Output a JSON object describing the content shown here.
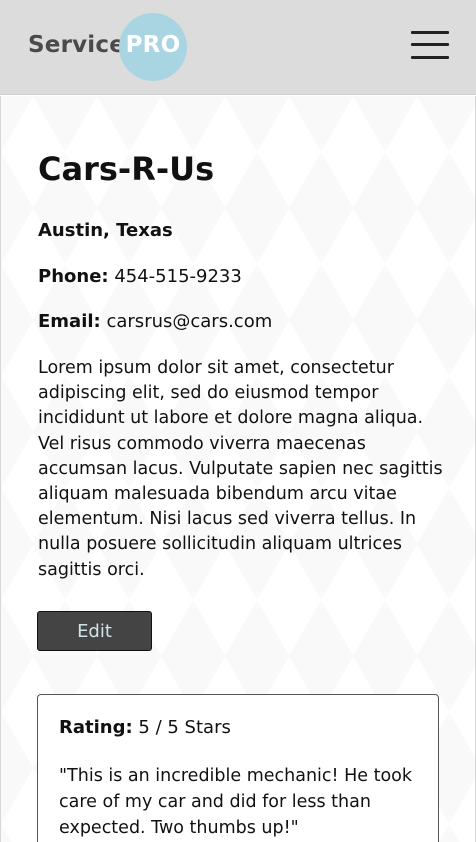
{
  "header": {
    "logo_service": "Service",
    "logo_pro": "PRO",
    "menu_icon": "hamburger-menu-icon"
  },
  "business": {
    "name": "Cars-R-Us",
    "location": "Austin, Texas",
    "phone_label": "Phone:",
    "phone": "454-515-9233",
    "email_label": "Email:",
    "email": "carsrus@cars.com",
    "description": "Lorem ipsum dolor sit amet, consectetur adipiscing elit, sed do eiusmod tempor incididunt ut labore et dolore magna aliqua. Vel risus commodo viverra maecenas accumsan lacus. Vulputate sapien nec sagittis aliquam malesuada bibendum arcu vitae elementum. Nisi lacus sed viverra tellus. In nulla posuere sollicitudin aliquam ultrices sagittis orci."
  },
  "actions": {
    "edit_label": "Edit"
  },
  "review": {
    "rating_label": "Rating:",
    "rating_value": "5 / 5 Stars",
    "rating_number": 5,
    "rating_max": 5,
    "text": "\"This is an incredible mechanic! He took care of my car and did for less than expected. Two thumbs up!\""
  },
  "colors": {
    "header_bg": "#dcdcdc",
    "logo_circle": "#a9d5e2",
    "button_bg": "#444444",
    "button_text": "#cfe3ea"
  }
}
